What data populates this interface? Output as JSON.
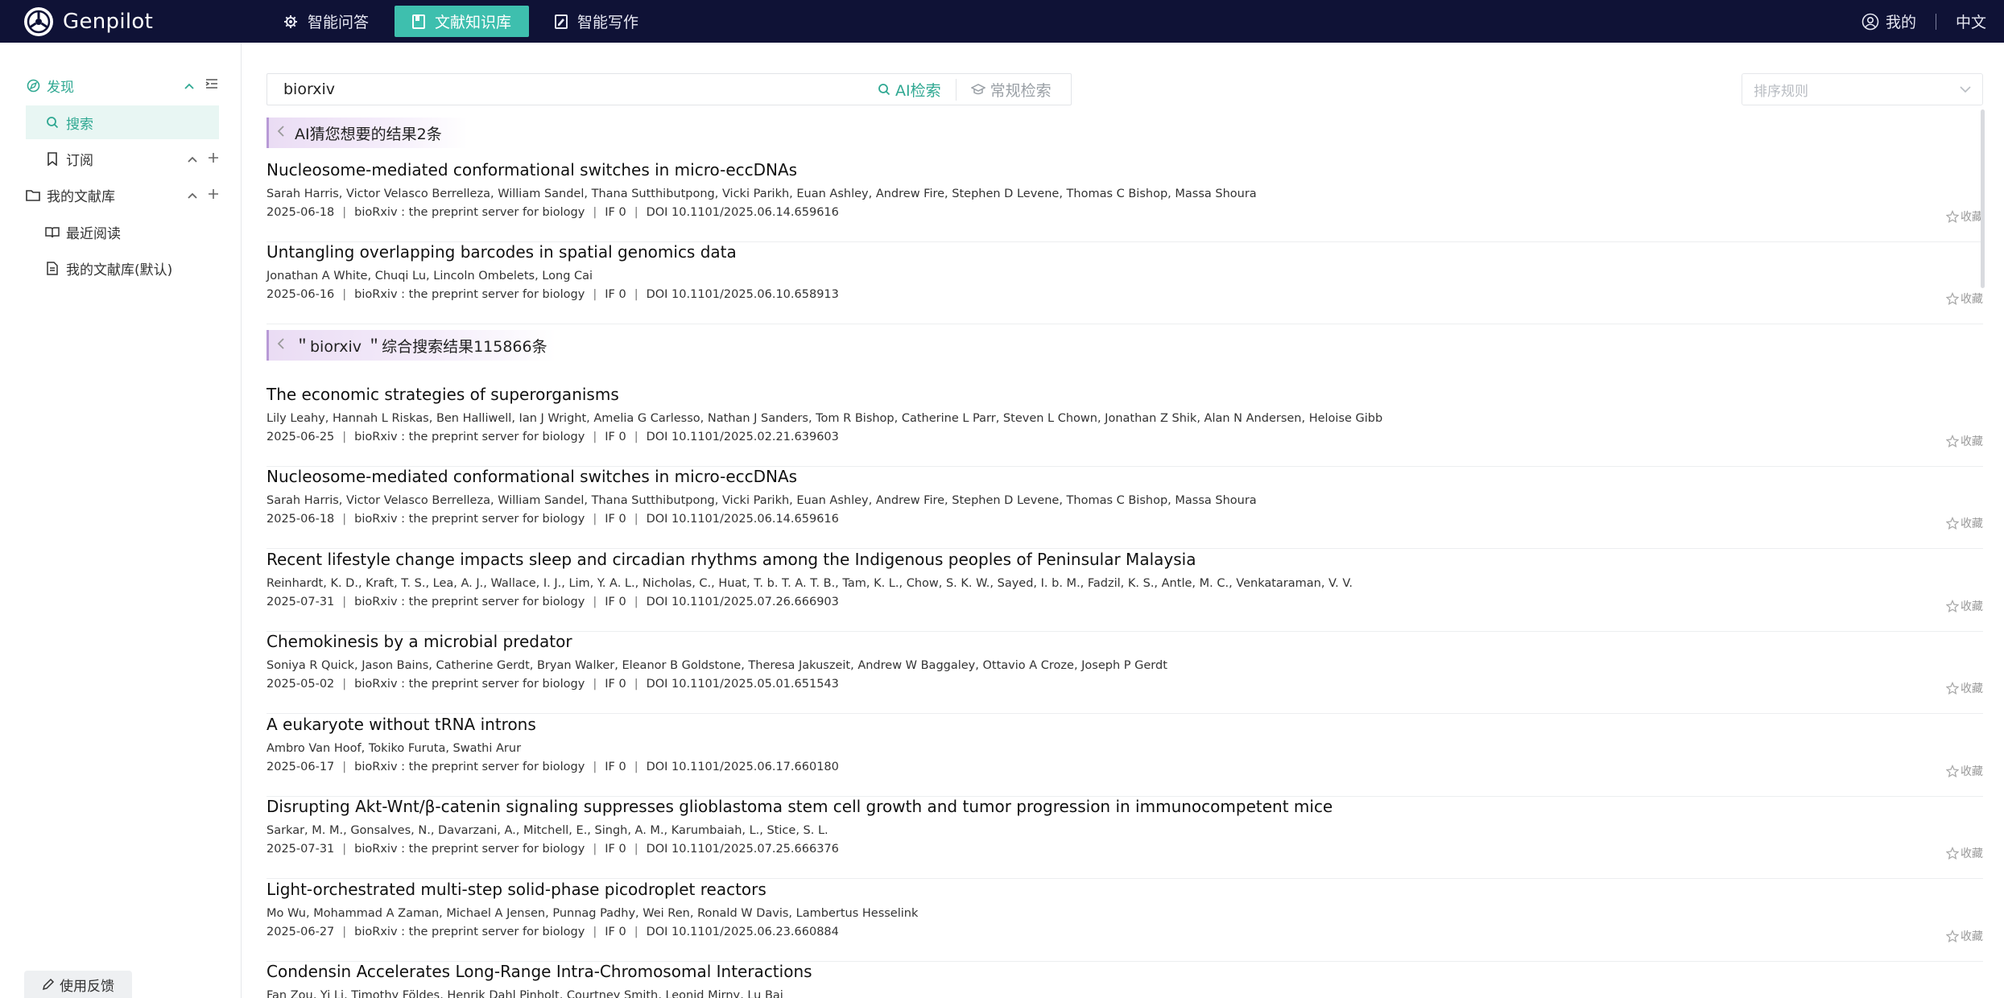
{
  "brand": {
    "name": "Genpilot"
  },
  "nav": {
    "tabs": [
      {
        "label": "智能问答",
        "icon": "gear-icon"
      },
      {
        "label": "文献知识库",
        "icon": "book-icon"
      },
      {
        "label": "智能写作",
        "icon": "write-icon"
      }
    ],
    "active_tab": "文献知识库",
    "user_label": "我的",
    "lang_label": "中文"
  },
  "sidebar": {
    "discover": {
      "label": "发现"
    },
    "search": {
      "label": "搜索"
    },
    "subscribe": {
      "label": "订阅"
    },
    "my_library": {
      "label": "我的文献库"
    },
    "recent": {
      "label": "最近阅读"
    },
    "default_lib": {
      "label": "我的文献库(默认)"
    },
    "feedback": "使用反馈"
  },
  "search": {
    "query": "biorxiv",
    "ai_label": "AI检索",
    "normal_label": "常规检索",
    "sort_placeholder": "排序规则"
  },
  "ai_section": {
    "heading": "AI猜您想要的结果2条",
    "results": [
      {
        "title": "Nucleosome-mediated conformational switches in micro-eccDNAs",
        "authors": "Sarah Harris, Victor Velasco Berrelleza, William Sandel, Thana Sutthibutpong, Vicki Parikh, Euan Ashley, Andrew Fire, Stephen D Levene, Thomas C Bishop, Massa Shoura",
        "date": "2025-06-18",
        "journal": "bioRxiv : the preprint server for biology",
        "if": "IF 0",
        "doi": "DOI 10.1101/2025.06.14.659616"
      },
      {
        "title": "Untangling overlapping barcodes in spatial genomics data",
        "authors": "Jonathan A White, Chuqi Lu, Lincoln Ombelets, Long Cai",
        "date": "2025-06-16",
        "journal": "bioRxiv : the preprint server for biology",
        "if": "IF 0",
        "doi": "DOI 10.1101/2025.06.10.658913"
      }
    ]
  },
  "main_section": {
    "heading": "＂biorxiv ＂综合搜索结果115866条",
    "results": [
      {
        "title": "The economic strategies of superorganisms",
        "authors": "Lily Leahy, Hannah L Riskas, Ben Halliwell, Ian J Wright, Amelia G Carlesso, Nathan J Sanders, Tom R Bishop, Catherine L Parr, Steven L Chown, Jonathan Z Shik, Alan N Andersen, Heloise Gibb",
        "date": "2025-06-25",
        "journal": "bioRxiv : the preprint server for biology",
        "if": "IF 0",
        "doi": "DOI 10.1101/2025.02.21.639603"
      },
      {
        "title": "Nucleosome-mediated conformational switches in micro-eccDNAs",
        "authors": "Sarah Harris, Victor Velasco Berrelleza, William Sandel, Thana Sutthibutpong, Vicki Parikh, Euan Ashley, Andrew Fire, Stephen D Levene, Thomas C Bishop, Massa Shoura",
        "date": "2025-06-18",
        "journal": "bioRxiv : the preprint server for biology",
        "if": "IF 0",
        "doi": "DOI 10.1101/2025.06.14.659616"
      },
      {
        "title": "Recent lifestyle change impacts sleep and circadian rhythms among the Indigenous peoples of Peninsular Malaysia",
        "authors": "Reinhardt, K. D., Kraft, T. S., Lea, A. J., Wallace, I. J., Lim, Y. A. L., Nicholas, C., Huat, T. b. T. A. T. B., Tam, K. L., Chow, S. K. W., Sayed, I. b. M., Fadzil, K. S., Antle, M. C., Venkataraman, V. V.",
        "date": "2025-07-31",
        "journal": "bioRxiv : the preprint server for biology",
        "if": "IF 0",
        "doi": "DOI 10.1101/2025.07.26.666903"
      },
      {
        "title": "Chemokinesis by a microbial predator",
        "authors": "Soniya R Quick, Jason Bains, Catherine Gerdt, Bryan Walker, Eleanor B Goldstone, Theresa Jakuszeit, Andrew W Baggaley, Ottavio A Croze, Joseph P Gerdt",
        "date": "2025-05-02",
        "journal": "bioRxiv : the preprint server for biology",
        "if": "IF 0",
        "doi": "DOI 10.1101/2025.05.01.651543"
      },
      {
        "title": "A eukaryote without tRNA introns",
        "authors": "Ambro Van Hoof, Tokiko Furuta, Swathi Arur",
        "date": "2025-06-17",
        "journal": "bioRxiv : the preprint server for biology",
        "if": "IF 0",
        "doi": "DOI 10.1101/2025.06.17.660180"
      },
      {
        "title": "Disrupting Akt-Wnt/β-catenin signaling suppresses glioblastoma stem cell growth and tumor progression in immunocompetent mice",
        "authors": "Sarkar, M. M., Gonsalves, N., Davarzani, A., Mitchell, E., Singh, A. M., Karumbaiah, L., Stice, S. L.",
        "date": "2025-07-31",
        "journal": "bioRxiv : the preprint server for biology",
        "if": "IF 0",
        "doi": "DOI 10.1101/2025.07.25.666376"
      },
      {
        "title": "Light-orchestrated multi-step solid-phase picodroplet reactors",
        "authors": "Mo Wu, Mohammad A Zaman, Michael A Jensen, Punnag Padhy, Wei Ren, Ronald W Davis, Lambertus Hesselink",
        "date": "2025-06-27",
        "journal": "bioRxiv : the preprint server for biology",
        "if": "IF 0",
        "doi": "DOI 10.1101/2025.06.23.660884"
      },
      {
        "title": "Condensin Accelerates Long-Range Intra-Chromosomal Interactions",
        "authors": "Fan Zou, Yi Li, Timothy Földes, Henrik Dahl Pinholt, Courtney Smith, Leonid Mirny, Lu Bai",
        "date": "",
        "journal": "",
        "if": "",
        "doi": ""
      }
    ]
  },
  "fav_label": "收藏",
  "accent_color": "#3ebfae"
}
